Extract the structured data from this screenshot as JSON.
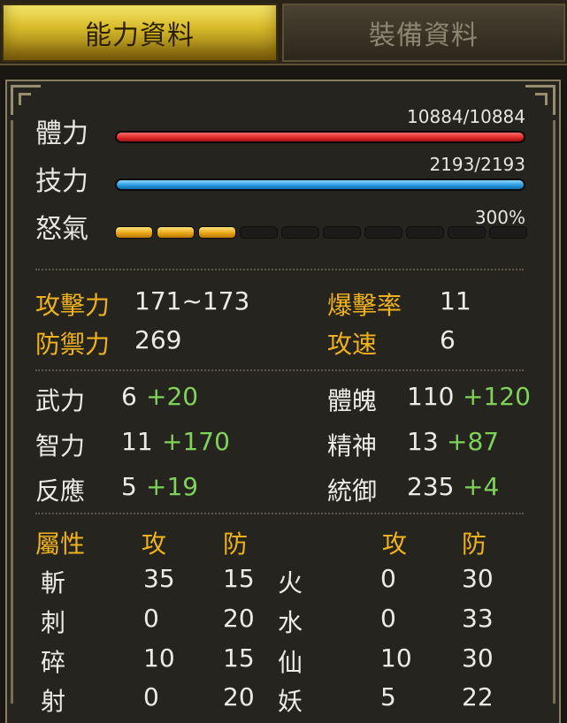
{
  "tabs": {
    "active": "能力資料",
    "inactive": "裝備資料"
  },
  "vitals": {
    "hp": {
      "label": "體力",
      "value": "10884/10884",
      "fill": 1.0,
      "color": "#e02a2a"
    },
    "mp": {
      "label": "技力",
      "value": "2193/2193",
      "fill": 1.0,
      "color": "#2a9be0"
    },
    "rage": {
      "label": "怒氣",
      "value": "300%",
      "segments_total": 10,
      "segments_filled": 3
    }
  },
  "combat": {
    "attack": {
      "label": "攻擊力",
      "value": "171~173"
    },
    "crit": {
      "label": "爆擊率",
      "value": "11"
    },
    "defense": {
      "label": "防禦力",
      "value": "269"
    },
    "speed": {
      "label": "攻速",
      "value": "6"
    }
  },
  "stats": [
    {
      "label": "武力",
      "base": "6",
      "bonus": "+20"
    },
    {
      "label": "體魄",
      "base": "110",
      "bonus": "+120"
    },
    {
      "label": "智力",
      "base": "11",
      "bonus": "+170"
    },
    {
      "label": "精神",
      "base": "13",
      "bonus": "+87"
    },
    {
      "label": "反應",
      "base": "5",
      "bonus": "+19"
    },
    {
      "label": "統御",
      "base": "235",
      "bonus": "+4"
    }
  ],
  "attributes": {
    "header": {
      "title": "屬性",
      "atk": "攻",
      "def": "防"
    },
    "rows": [
      {
        "left": "斬",
        "latk": "35",
        "ldef": "15",
        "right": "火",
        "ratk": "0",
        "rdef": "30"
      },
      {
        "left": "刺",
        "latk": "0",
        "ldef": "20",
        "right": "水",
        "ratk": "0",
        "rdef": "33"
      },
      {
        "left": "碎",
        "latk": "10",
        "ldef": "15",
        "right": "仙",
        "ratk": "10",
        "rdef": "30"
      },
      {
        "left": "射",
        "latk": "0",
        "ldef": "20",
        "right": "妖",
        "ratk": "5",
        "rdef": "22"
      }
    ]
  }
}
